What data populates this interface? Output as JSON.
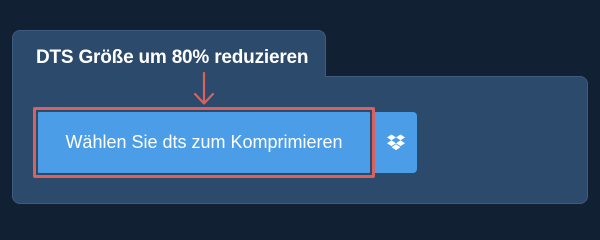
{
  "panel": {
    "title": "DTS Größe um 80% reduzieren"
  },
  "upload": {
    "button_label": "Wählen Sie dts zum Komprimieren",
    "alt_source_icon": "dropbox-icon"
  },
  "colors": {
    "background": "#122033",
    "panel": "#2c4a6b",
    "button": "#4a9de6",
    "highlight": "#d9625f"
  }
}
